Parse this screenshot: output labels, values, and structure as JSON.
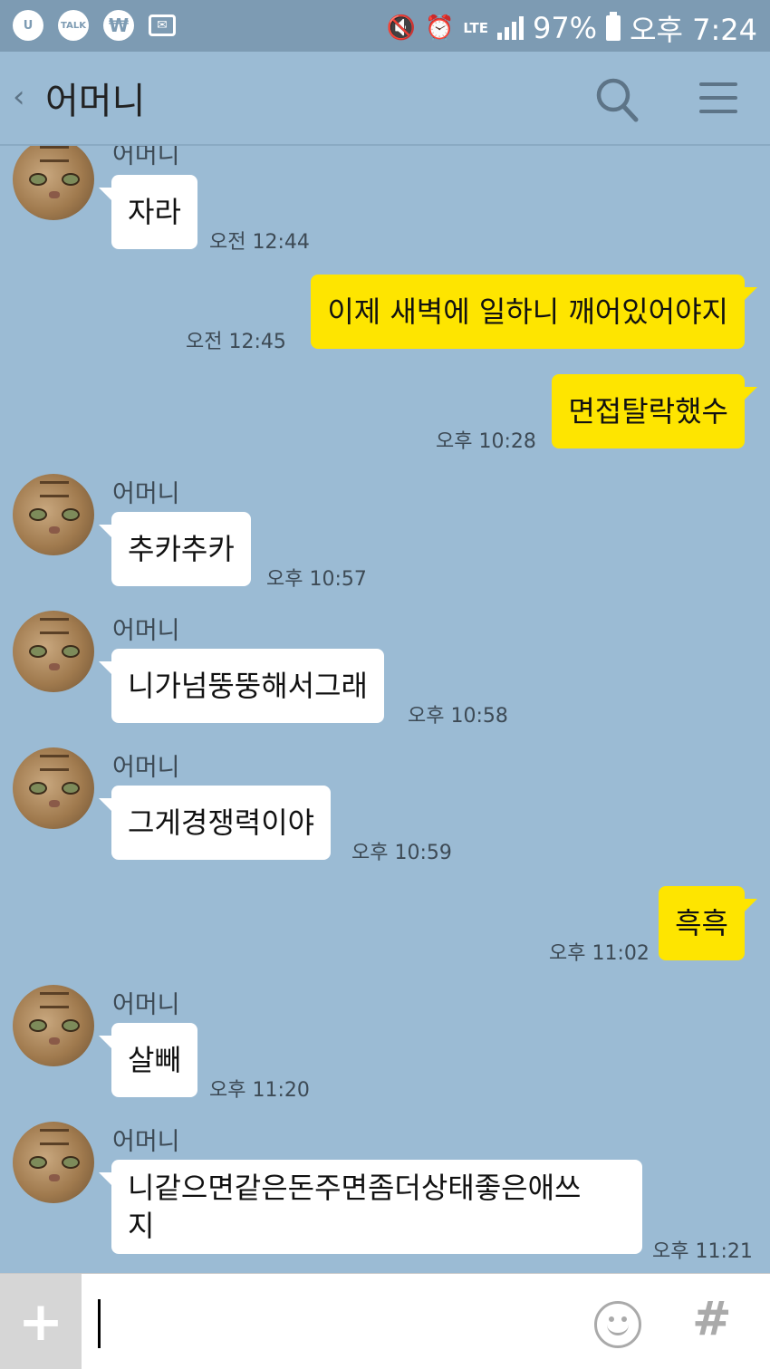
{
  "status_bar": {
    "icons_left": [
      "u-plus-icon",
      "kakaotalk-icon",
      "won-icon",
      "mail-icon"
    ],
    "talk_badge": "TALK",
    "won_badge": "₩",
    "lte": "LTE",
    "battery": "97%",
    "time": "오후 7:24"
  },
  "header": {
    "back_glyph": "‹",
    "title": "어머니"
  },
  "messages": [
    {
      "side": "in",
      "sender": "어머니",
      "text": "자라",
      "time": "오전 12:44"
    },
    {
      "side": "out",
      "text": "이제 새벽에 일하니 깨어있어야지",
      "time": "오전 12:45"
    },
    {
      "side": "out",
      "text": "면접탈락했수",
      "time": "오후 10:28"
    },
    {
      "side": "in",
      "sender": "어머니",
      "text": "추카추카",
      "time": "오후 10:57"
    },
    {
      "side": "in",
      "sender": "어머니",
      "text": "니가넘뚱뚱해서그래",
      "time": "오후 10:58"
    },
    {
      "side": "in",
      "sender": "어머니",
      "text": "그게경쟁력이야",
      "time": "오후 10:59"
    },
    {
      "side": "out",
      "text": "흑흑",
      "time": "오후 11:02"
    },
    {
      "side": "in",
      "sender": "어머니",
      "text": "살빼",
      "time": "오후 11:20"
    },
    {
      "side": "in",
      "sender": "어머니",
      "text": "니같으면같은돈주면좀더상태좋은애쓰",
      "text2": "지",
      "time": "오후 11:21"
    }
  ],
  "input_bar": {
    "plus_glyph": "+",
    "hash_glyph": "#"
  }
}
